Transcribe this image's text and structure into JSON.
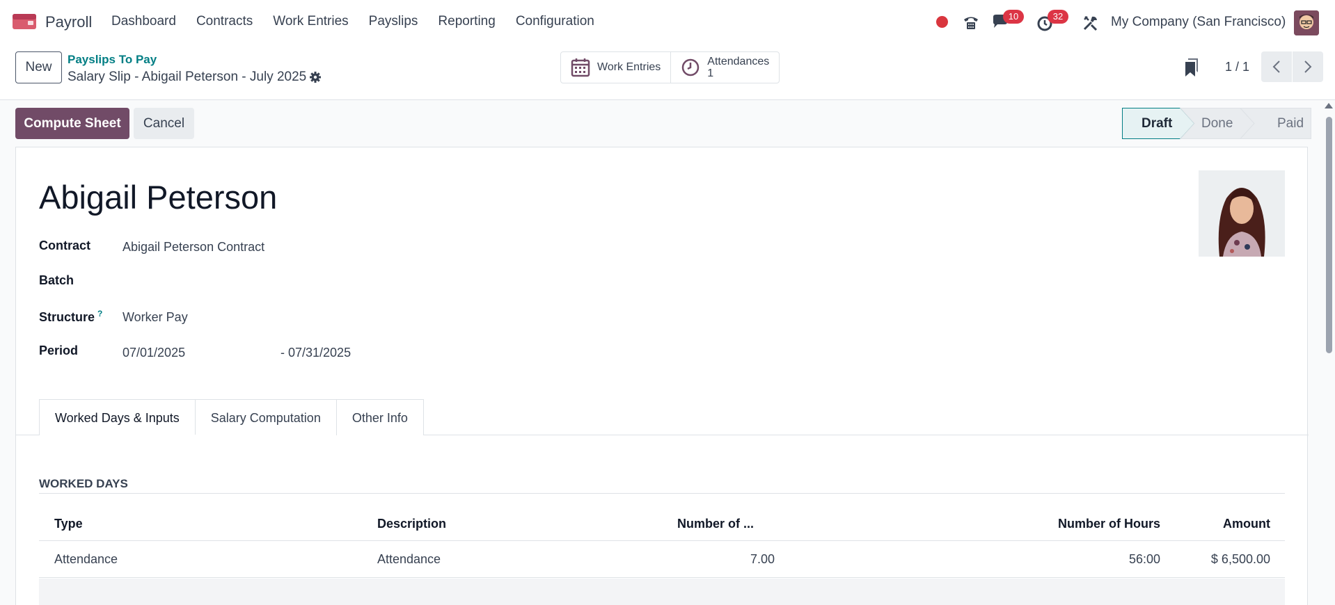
{
  "navbar": {
    "app_name": "Payroll",
    "menu": [
      "Dashboard",
      "Contracts",
      "Work Entries",
      "Payslips",
      "Reporting",
      "Configuration"
    ],
    "chat_badge": "10",
    "activity_badge": "32",
    "company": "My Company (San Francisco)"
  },
  "control": {
    "new_label": "New",
    "breadcrumb": "Payslips To Pay",
    "record_title": "Salary Slip - Abigail Peterson - July 2025",
    "work_entries_label": "Work Entries",
    "attendances_label": "Attendances",
    "attendances_count": "1",
    "pager": "1 / 1"
  },
  "actions": {
    "compute_label": "Compute Sheet",
    "cancel_label": "Cancel"
  },
  "status": {
    "steps": [
      "Draft",
      "Done",
      "Paid"
    ],
    "current": "Draft"
  },
  "form": {
    "employee_name": "Abigail Peterson",
    "contract_label": "Contract",
    "contract_value": "Abigail Peterson Contract",
    "batch_label": "Batch",
    "batch_value": "",
    "structure_label": "Structure",
    "structure_help": "?",
    "structure_value": "Worker Pay",
    "period_label": "Period",
    "period_start": "07/01/2025",
    "period_end": "- 07/31/2025"
  },
  "tabs": [
    "Worked Days & Inputs",
    "Salary Computation",
    "Other Info"
  ],
  "worked_days": {
    "section_title": "WORKED DAYS",
    "columns": [
      "Type",
      "Description",
      "Number of ...",
      "Number of Hours",
      "Amount"
    ],
    "rows": [
      {
        "type": "Attendance",
        "description": "Attendance",
        "days": "7.00",
        "hours": "56:00",
        "amount": "$ 6,500.00"
      }
    ]
  },
  "colors": {
    "brand": "#714b67",
    "link": "#017e84",
    "badge": "#dc3545"
  }
}
